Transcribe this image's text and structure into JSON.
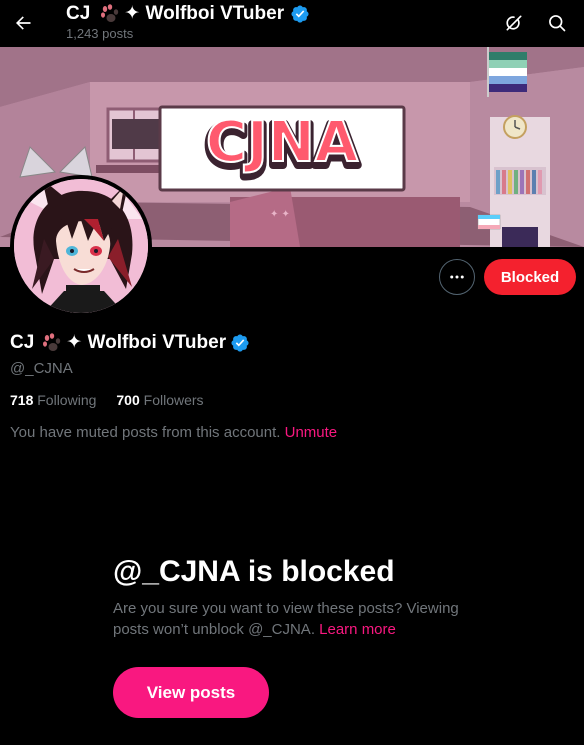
{
  "header": {
    "name_prefix": "CJ",
    "name_suffix": "✦ Wolfboi VTuber",
    "post_count": "1,243 posts"
  },
  "banner": {
    "logo_text": "CJNA"
  },
  "profile": {
    "name_prefix": "CJ",
    "name_suffix": "✦ Wolfboi VTuber",
    "handle": "@_CJNA",
    "following_count": "718",
    "following_label": "Following",
    "followers_count": "700",
    "followers_label": "Followers",
    "muted_text": "You have muted posts from this account.",
    "unmute_label": "Unmute"
  },
  "actions": {
    "blocked_label": "Blocked"
  },
  "blocked_notice": {
    "title": "@_CJNA is blocked",
    "description": "Are you sure you want to view these posts? Viewing posts won’t unblock @_CJNA.",
    "learn_more": "Learn more",
    "view_posts_label": "View posts"
  },
  "colors": {
    "accent_pink": "#f91880",
    "blocked_red": "#f4212e",
    "verified_blue": "#1d9bf0",
    "muted_gray": "#71767b"
  },
  "icons": [
    "back-arrow-icon",
    "grok-icon",
    "search-icon",
    "verified-badge-icon",
    "paw-emoji-icon",
    "more-dots-icon"
  ]
}
